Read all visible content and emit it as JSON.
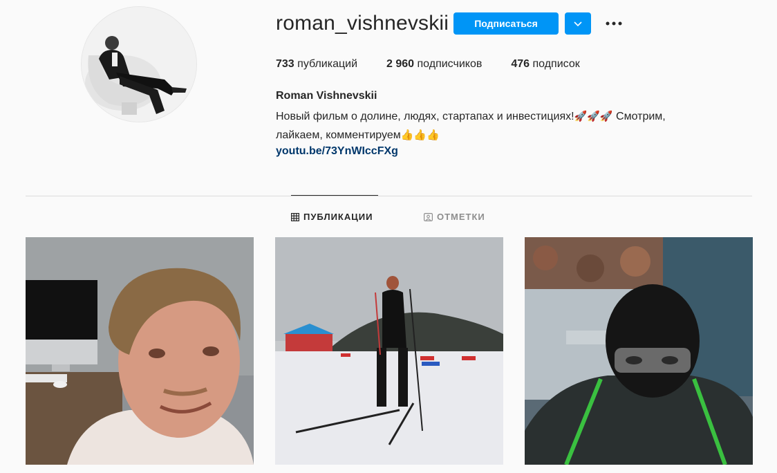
{
  "profile": {
    "username": "roman_vishnevskii",
    "follow_label": "Подписаться",
    "full_name": "Roman Vishnevskii",
    "bio_line1": "Новый фильм о долине, людях, стартапах и инвестициях!",
    "bio_rockets": "🚀🚀🚀",
    "bio_line1_end": " Смотрим,",
    "bio_line2": "лайкаем, комментируем",
    "bio_thumbs": "👍👍👍",
    "link": "youtu.be/73YnWIccFXg"
  },
  "stats": {
    "posts_count": "733",
    "posts_label": "публикаций",
    "followers_count": "2 960",
    "followers_label": "подписчиков",
    "following_count": "476",
    "following_label": "подписок"
  },
  "tabs": {
    "posts": "ПУБЛИКАЦИИ",
    "tagged": "ОТМЕТКИ"
  },
  "icons": {
    "dropdown": "chevron-down-icon",
    "more": "more-dots-icon",
    "grid": "grid-icon",
    "tagged": "tag-person-icon"
  },
  "colors": {
    "accent": "#0095f6",
    "link": "#00376b",
    "background": "#fafafa"
  }
}
